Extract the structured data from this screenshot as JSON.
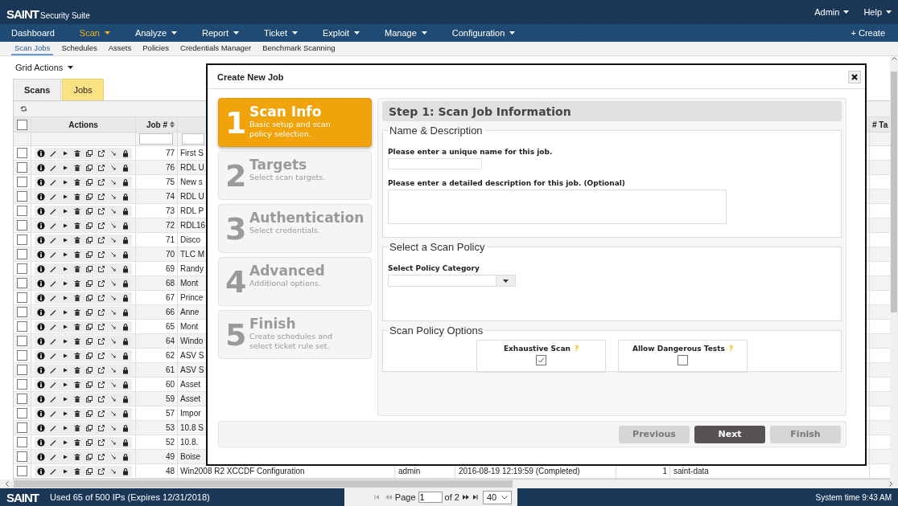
{
  "header": {
    "logo": "SAINT",
    "product": "Security Suite",
    "menus": [
      {
        "label": "Admin"
      },
      {
        "label": "Help"
      }
    ]
  },
  "nav": {
    "items": [
      {
        "label": "Dashboard",
        "dropdown": false,
        "selected": false
      },
      {
        "label": "Scan",
        "dropdown": true,
        "selected": true
      },
      {
        "label": "Analyze",
        "dropdown": true,
        "selected": false
      },
      {
        "label": "Report",
        "dropdown": true,
        "selected": false
      },
      {
        "label": "Ticket",
        "dropdown": true,
        "selected": false
      },
      {
        "label": "Exploit",
        "dropdown": true,
        "selected": false
      },
      {
        "label": "Manage",
        "dropdown": true,
        "selected": false
      },
      {
        "label": "Configuration",
        "dropdown": true,
        "selected": false
      }
    ],
    "create": "+ Create"
  },
  "subnav": [
    {
      "label": "Scan Jobs",
      "selected": true
    },
    {
      "label": "Schedules",
      "selected": false
    },
    {
      "label": "Assets",
      "selected": false
    },
    {
      "label": "Policies",
      "selected": false
    },
    {
      "label": "Credentials Manager",
      "selected": false
    },
    {
      "label": "Benchmark Scanning",
      "selected": false
    }
  ],
  "grid_actions": "Grid Actions",
  "tabs": [
    {
      "label": "Scans",
      "selected": false
    },
    {
      "label": "Jobs",
      "selected": true
    }
  ],
  "grid": {
    "columns": {
      "actions": "Actions",
      "job_number": "Job #",
      "column_9": "# Ta"
    },
    "select_all": {
      "checked": false
    },
    "rows": [
      {
        "checked": false,
        "job": "77",
        "name": "First S"
      },
      {
        "checked": false,
        "job": "76",
        "name": "RDL U"
      },
      {
        "checked": false,
        "job": "75",
        "name": "New s"
      },
      {
        "checked": false,
        "job": "74",
        "name": "RDL U"
      },
      {
        "checked": false,
        "job": "73",
        "name": "RDL P"
      },
      {
        "checked": false,
        "job": "72",
        "name": "RDL16"
      },
      {
        "checked": false,
        "job": "71",
        "name": "Disco"
      },
      {
        "checked": false,
        "job": "70",
        "name": "TLC M"
      },
      {
        "checked": false,
        "job": "69",
        "name": "Randy"
      },
      {
        "checked": false,
        "job": "68",
        "name": "Mont"
      },
      {
        "checked": false,
        "job": "67",
        "name": "Prince"
      },
      {
        "checked": false,
        "job": "66",
        "name": "Anne"
      },
      {
        "checked": false,
        "job": "65",
        "name": "Mont"
      },
      {
        "checked": false,
        "job": "64",
        "name": "Windo"
      },
      {
        "checked": false,
        "job": "62",
        "name": "ASV S"
      },
      {
        "checked": false,
        "job": "61",
        "name": "ASV S"
      },
      {
        "checked": false,
        "job": "60",
        "name": "Asset"
      },
      {
        "checked": false,
        "job": "59",
        "name": "Asset"
      },
      {
        "checked": false,
        "job": "57",
        "name": "Impor"
      },
      {
        "checked": false,
        "job": "53",
        "name": "10.8 S"
      },
      {
        "checked": false,
        "job": "52",
        "name": "10.8."
      },
      {
        "checked": false,
        "job": "49",
        "name": "Boise"
      },
      {
        "checked": false,
        "job": "48",
        "name": "Win2008 R2 XCCDF Configuration",
        "owner": "admin",
        "date": "2016-08-19 12:19:59 (Completed)",
        "targets": "1",
        "repository": "saint-data"
      }
    ]
  },
  "status_bar": {
    "logo": "SAINT",
    "usage": "Used 65 of 500 IPs (Expires 12/31/2018)",
    "pager": {
      "buttons": [
        {
          "kind": "first",
          "disabled": true
        },
        {
          "kind": "prev",
          "disabled": true
        },
        {
          "kind": "next",
          "disabled": false
        },
        {
          "kind": "last",
          "disabled": false
        }
      ],
      "page_label": "Page",
      "page": "1",
      "of": "of 2",
      "page_size": "40"
    },
    "system_time": "System time 9:43 AM"
  },
  "modal": {
    "title": "Create New Job",
    "steps": [
      {
        "number": "1",
        "title": "Scan Info",
        "description": "Basic setup and scan policy selection.",
        "selected": true
      },
      {
        "number": "2",
        "title": "Targets",
        "description": "Select scan targets.",
        "selected": false
      },
      {
        "number": "3",
        "title": "Authentication",
        "description": "Select credentials.",
        "selected": false
      },
      {
        "number": "4",
        "title": "Advanced",
        "description": "Additional options.",
        "selected": false
      },
      {
        "number": "5",
        "title": "Finish",
        "description": "Create schedules and select ticket rule set.",
        "selected": false
      }
    ],
    "heading": "Step 1: Scan Job Information",
    "sections": [
      {
        "legend": "Name & Description",
        "fields": [
          {
            "kind": "text",
            "label": "Please enter a unique name for this job."
          },
          {
            "kind": "textarea",
            "label": "Please enter a detailed description for this job. (Optional)"
          }
        ]
      },
      {
        "legend": "Select a Scan Policy",
        "fields": [
          {
            "kind": "select",
            "label": "Select Policy Category"
          }
        ]
      },
      {
        "legend": "Scan Policy Options",
        "fields": [
          {
            "kind": "checkbox",
            "label": "Exhaustive Scan",
            "help": "?",
            "checked": true
          },
          {
            "kind": "checkbox",
            "label": "Allow Dangerous Tests",
            "help": "?",
            "checked": false
          }
        ]
      }
    ],
    "buttons": [
      {
        "label": "Previous",
        "disabled": true
      },
      {
        "label": "Next",
        "disabled": false
      },
      {
        "label": "Finish",
        "disabled": true
      }
    ]
  }
}
